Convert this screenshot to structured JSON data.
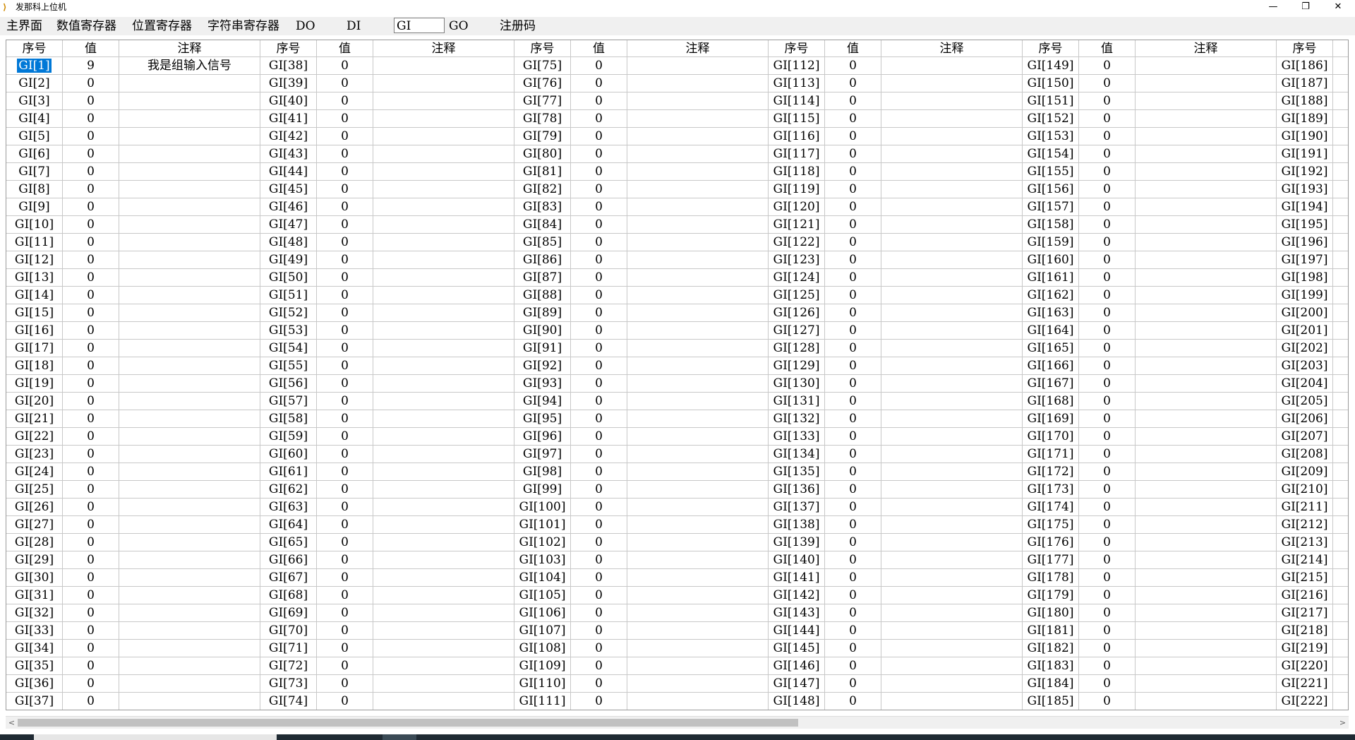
{
  "window": {
    "title": "发那科上位机",
    "minimize_label": "—",
    "maximize_label": "❐",
    "close_label": "✕"
  },
  "menu": {
    "tabs": [
      {
        "label": "主界面"
      },
      {
        "label": "数值寄存器"
      },
      {
        "label": "位置寄存器"
      },
      {
        "label": "字符串寄存器"
      },
      {
        "label": "DO"
      },
      {
        "label": "DI"
      },
      {
        "label": "GI",
        "active": true
      },
      {
        "label": "GO"
      },
      {
        "label": "注册码"
      }
    ]
  },
  "table": {
    "headers": [
      "序号",
      "值",
      "注释"
    ],
    "prefix": "GI",
    "rows_per_group": 37,
    "visible_groups": 6,
    "default_value": "0",
    "special_cells": [
      {
        "index": 1,
        "value": "9",
        "comment": "我是组输入信号",
        "selected": true
      }
    ]
  },
  "scrollbar": {
    "left_arrow": "<",
    "right_arrow": ">"
  }
}
